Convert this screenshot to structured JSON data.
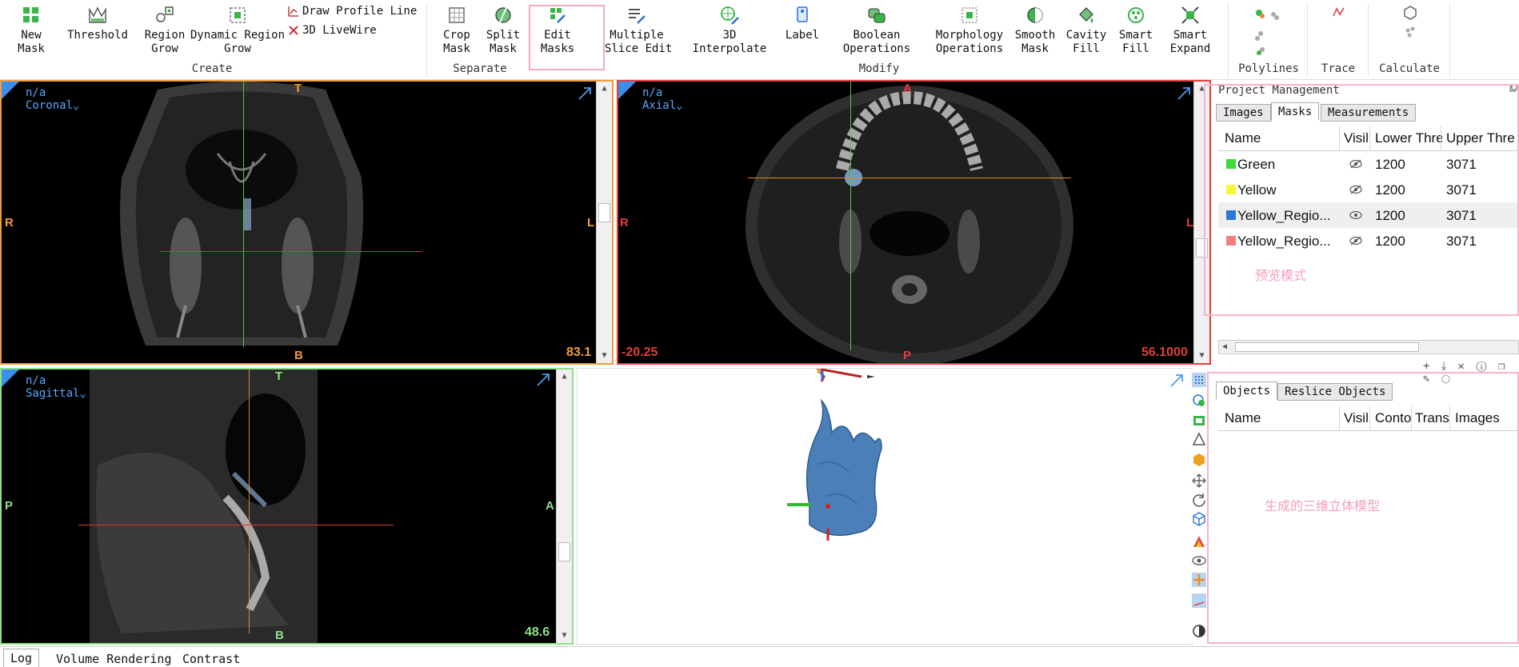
{
  "ribbon": {
    "create": {
      "group_label": "Create",
      "new_mask": "New\nMask",
      "threshold": "Threshold",
      "region_grow": "Region\nGrow",
      "dynamic_region_grow": "Dynamic Region\nGrow",
      "draw_profile_line": "Draw Profile Line",
      "livewire": "3D LiveWire"
    },
    "separate": {
      "group_label": "Separate",
      "crop_mask": "Crop\nMask",
      "split_mask": "Split\nMask",
      "edit_masks": "Edit\nMasks"
    },
    "modify": {
      "group_label": "Modify",
      "multiple_slice_edit": "Multiple\nSlice Edit",
      "interpolate_3d": "3D Interpolate",
      "label": "Label",
      "boolean_operations": "Boolean\nOperations",
      "morphology_operations": "Morphology\nOperations",
      "smooth_mask": "Smooth\nMask",
      "cavity_fill": "Cavity\nFill",
      "smart_fill": "Smart\nFill",
      "smart_expand": "Smart\nExpand"
    },
    "polylines_label": "Polylines",
    "trace_label": "Trace",
    "calculate_label": "Calculate"
  },
  "views": {
    "coronal": {
      "title": "n/a",
      "name": "Coronal⌄",
      "top": "T",
      "bottom": "B",
      "left": "R",
      "right": "L",
      "slice": "83.1"
    },
    "axial": {
      "title": "n/a",
      "name": "Axial⌄",
      "top": "A",
      "bottom": "P",
      "left": "R",
      "right": "L",
      "slice": "56.1000",
      "left_value": "-20.25"
    },
    "sagittal": {
      "title": "n/a",
      "name": "Sagittal⌄",
      "top": "T",
      "bottom": "B",
      "left": "P",
      "right": "A",
      "slice": "48.6"
    }
  },
  "project_management": {
    "title": "Project Management",
    "tabs": [
      "Images",
      "Masks",
      "Measurements"
    ],
    "active_tab": "Masks",
    "columns": [
      "Name",
      "Visil",
      "Lower Thre",
      "Upper Thre"
    ],
    "rows": [
      {
        "name": "Green",
        "color": "#3ddc3d",
        "visible": false,
        "lower": "1200",
        "upper": "3071"
      },
      {
        "name": "Yellow",
        "color": "#f5f53a",
        "visible": false,
        "lower": "1200",
        "upper": "3071"
      },
      {
        "name": "Yellow_Regio...",
        "color": "#2b7bd6",
        "visible": true,
        "lower": "1200",
        "upper": "3071"
      },
      {
        "name": "Yellow_Regio...",
        "color": "#f07f7f",
        "visible": false,
        "lower": "1200",
        "upper": "3071"
      }
    ],
    "annotation_preview": "预览模式"
  },
  "objects_panel": {
    "tabs": [
      "Objects",
      "Reslice Objects"
    ],
    "active_tab": "Objects",
    "columns": [
      "Name",
      "Visil",
      "Conto",
      "Trans",
      "Images"
    ],
    "annotation_model": "生成的三维立体模型"
  },
  "bottom_tabs": [
    "Log",
    "Volume Rendering",
    "Contrast"
  ],
  "colors": {
    "orange_border": "#f39a3d",
    "red_border": "#e33d3d",
    "green_border": "#8fe088",
    "annotation_pink": "#f59cc1",
    "mask_blue": "#4a7fb8"
  }
}
